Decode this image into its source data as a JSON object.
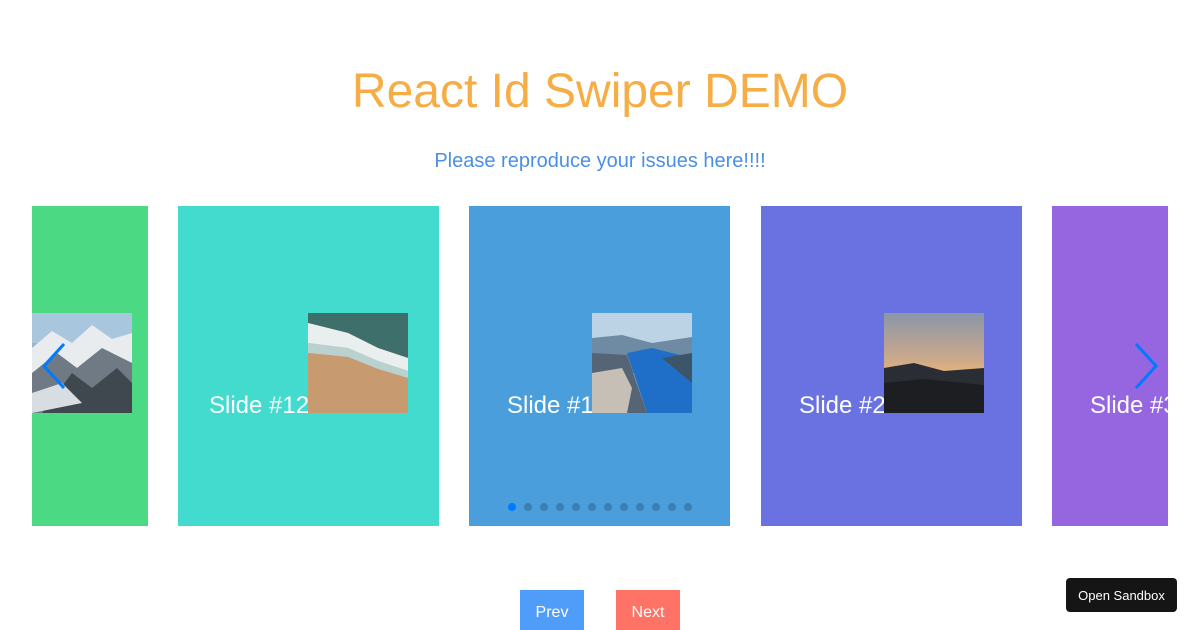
{
  "header": {
    "title": "React Id Swiper DEMO",
    "subtitle": "Please reproduce your issues here!!!!"
  },
  "slides": [
    {
      "label": "",
      "color": "#4cd983",
      "image": "mountain-snow-image"
    },
    {
      "label": "Slide #12",
      "color": "#43dbce",
      "image": "beach-waves-image"
    },
    {
      "label": "Slide #1",
      "color": "#4a9edb",
      "image": "fjord-cliff-image"
    },
    {
      "label": "Slide #2",
      "color": "#6a72e1",
      "image": "sunset-sea-image"
    },
    {
      "label": "Slide #3",
      "color": "#9566e0",
      "image": ""
    }
  ],
  "navigation": {
    "prev_icon": "chevron-left-icon",
    "next_icon": "chevron-right-icon",
    "arrow_color": "#007aff"
  },
  "pagination": {
    "total": 12,
    "active_index": 0
  },
  "buttons": {
    "prev_label": "Prev",
    "next_label": "Next"
  },
  "sandbox": {
    "label": "Open Sandbox"
  }
}
